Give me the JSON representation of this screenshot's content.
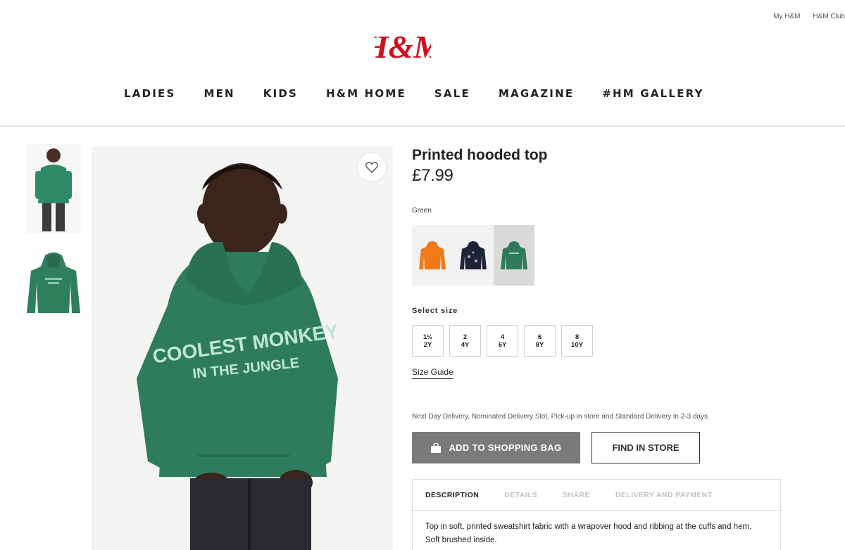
{
  "header": {
    "top_links": [
      "My H&M",
      "H&M Club"
    ],
    "logo_text": "H&M",
    "brand_color": "#d0101d",
    "nav": [
      "LADIES",
      "MEN",
      "KIDS",
      "H&M HOME",
      "SALE",
      "MAGAZINE",
      "#HM GALLERY"
    ]
  },
  "product": {
    "name": "Printed hooded top",
    "price": "£7.99",
    "color_label": "Green",
    "hoodie_print_line1": "COOLEST MONKEY",
    "hoodie_print_line2": "IN THE JUNGLE",
    "swatches": [
      {
        "color": "#f07a1a",
        "selected": false
      },
      {
        "color": "#1d2436",
        "selected": false
      },
      {
        "color": "#2f7a5a",
        "selected": true
      }
    ],
    "size_title": "Select size",
    "sizes": [
      {
        "top": "1½",
        "bottom": "2Y"
      },
      {
        "top": "2",
        "bottom": "4Y"
      },
      {
        "top": "4",
        "bottom": "6Y"
      },
      {
        "top": "6",
        "bottom": "8Y"
      },
      {
        "top": "8",
        "bottom": "10Y"
      }
    ],
    "size_guide": "Size Guide",
    "delivery_note": "Next Day Delivery, Nominated Delivery Slot, Pick-up in store and Standard Delivery in 2-3 days.",
    "add_to_bag": "ADD TO SHOPPING BAG",
    "find_in_store": "FIND IN STORE",
    "tabs": [
      "DESCRIPTION",
      "DETAILS",
      "SHARE",
      "DELIVERY AND PAYMENT"
    ],
    "active_tab": "DESCRIPTION",
    "description": "Top in soft, printed sweatshirt fabric with a wrapover hood and ribbing at the cuffs and hem. Soft brushed inside."
  }
}
